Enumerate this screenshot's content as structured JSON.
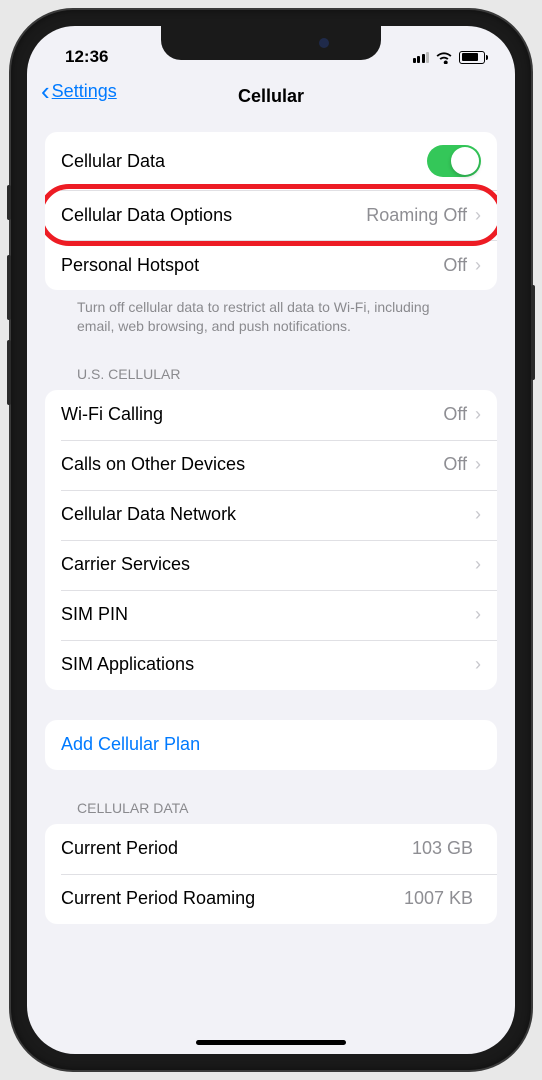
{
  "status": {
    "time": "12:36"
  },
  "nav": {
    "back": "Settings",
    "title": "Cellular"
  },
  "groups": {
    "main": {
      "cellular_data_label": "Cellular Data",
      "cellular_data_options_label": "Cellular Data Options",
      "cellular_data_options_value": "Roaming Off",
      "personal_hotspot_label": "Personal Hotspot",
      "personal_hotspot_value": "Off",
      "footer": "Turn off cellular data to restrict all data to Wi-Fi, including email, web browsing, and push notifications."
    },
    "carrier": {
      "header": "U.S. CELLULAR",
      "wifi_calling_label": "Wi-Fi Calling",
      "wifi_calling_value": "Off",
      "calls_other_label": "Calls on Other Devices",
      "calls_other_value": "Off",
      "data_network_label": "Cellular Data Network",
      "carrier_services_label": "Carrier Services",
      "sim_pin_label": "SIM PIN",
      "sim_apps_label": "SIM Applications"
    },
    "plan": {
      "add_plan_label": "Add Cellular Plan"
    },
    "data_usage": {
      "header": "CELLULAR DATA",
      "current_period_label": "Current Period",
      "current_period_value": "103 GB",
      "current_period_roaming_label": "Current Period Roaming",
      "current_period_roaming_value": "1007 KB"
    }
  }
}
